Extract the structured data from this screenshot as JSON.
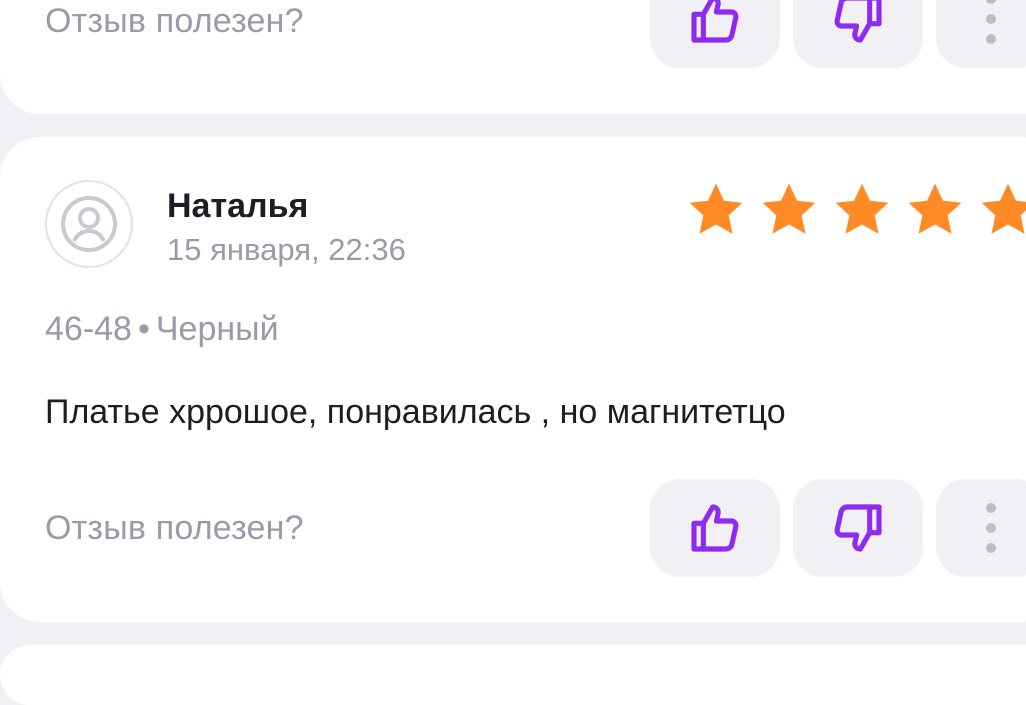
{
  "colors": {
    "background": "#f1f0f5",
    "card": "#ffffff",
    "accent_purple": "#8f2bf0",
    "star_orange": "#ff8a26",
    "muted_text": "#9b9aa8"
  },
  "previous_review": {
    "helpful_question": "Отзыв полезен?"
  },
  "review": {
    "author": "Наталья",
    "date": "15 января, 22:36",
    "rating": 5,
    "size": "46-48",
    "separator": "•",
    "color": "Черный",
    "text": "Платье хррошое, понравилась , но магнитетцо",
    "helpful_question": "Отзыв полезен?"
  },
  "icons": {
    "avatar": "user-avatar-icon",
    "like": "thumbs-up-icon",
    "dislike": "thumbs-down-icon",
    "more": "more-vertical-icon",
    "star": "star-icon"
  }
}
